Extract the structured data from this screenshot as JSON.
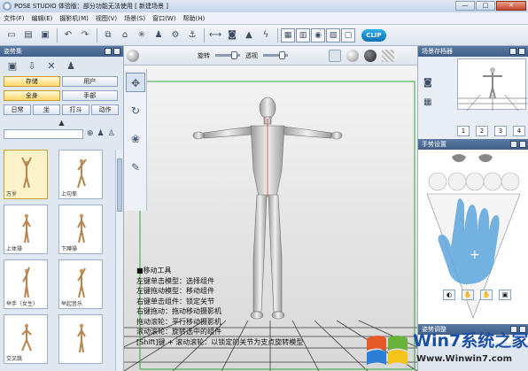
{
  "window": {
    "title": "POSE STUDIO 体验版：部分功能无法使用 [ 新建场景 ]",
    "controls": {
      "minimize": "—",
      "maximize": "□",
      "close": "✕"
    }
  },
  "menubar": {
    "items": [
      "文件(F)",
      "编辑(E)",
      "摄影机(M)",
      "视图(V)",
      "场景(S)",
      "窗口(W)",
      "帮助(H)"
    ]
  },
  "toolbar": {
    "icons": [
      "new-icon",
      "open-icon",
      "save-icon",
      "undo-icon",
      "redo-icon",
      "copy-icon",
      "pose-icon",
      "joint-icon",
      "model-icon",
      "gear-icon",
      "link-icon",
      "ruler-icon",
      "camera-icon",
      "landscape-icon",
      "lightning-icon",
      "panel-icon",
      "layout-icon",
      "screenshot-icon",
      "export-icon",
      "window-icon"
    ],
    "logo": "CLIP"
  },
  "left_panel": {
    "title": "姿势集",
    "tabs_main": [
      "存储",
      "用户"
    ],
    "tabs_sub": [
      "全身",
      "手部"
    ],
    "filters": [
      "日常",
      "坐",
      "打斗",
      "动作"
    ],
    "expander": "▲",
    "thumbnails": [
      {
        "label": "万岁",
        "selected": true
      },
      {
        "label": "上勾拳",
        "selected": false
      },
      {
        "label": "上体操",
        "selected": false
      },
      {
        "label": "下蹲操",
        "selected": false
      },
      {
        "label": "举手（女生）",
        "selected": false
      },
      {
        "label": "举起音乐",
        "selected": false
      },
      {
        "label": "交叉跳",
        "selected": false
      },
      {
        "label": "",
        "selected": false
      }
    ]
  },
  "viewport": {
    "rotate_label": "旋转",
    "opacity_label": "透视",
    "tools": [
      "move-icon",
      "rotate-icon",
      "joint-icon",
      "pen-icon"
    ],
    "help_lines": [
      "■移动工具",
      "左键单击模型：选择组件",
      "左键拖动模型：移动组件",
      "右键单击组件：锁定关节",
      "右键拖动：拖动移动摄影机",
      "拖动滚轮：平行移动摄影机",
      "滚动滚轮：旋转选中的组件",
      "[Shift]键 + 滚动滚轮：以锁定的关节为支点旋转模型"
    ]
  },
  "right_panel": {
    "camera_title": "场景存档器",
    "camera_buttons": [
      "1",
      "2",
      "3",
      "4"
    ],
    "hand_title": "手势设置",
    "bottom_title": "姿势调整"
  },
  "watermark": {
    "text": "Win7系统之家",
    "url": "Www.Winwin7.com"
  },
  "colors": {
    "accent": "#3f5e88",
    "selected": "#ffd96a",
    "grid": "#4a4a4a",
    "frame_green": "#34a836",
    "hand_blue": "#5aa4dc"
  }
}
